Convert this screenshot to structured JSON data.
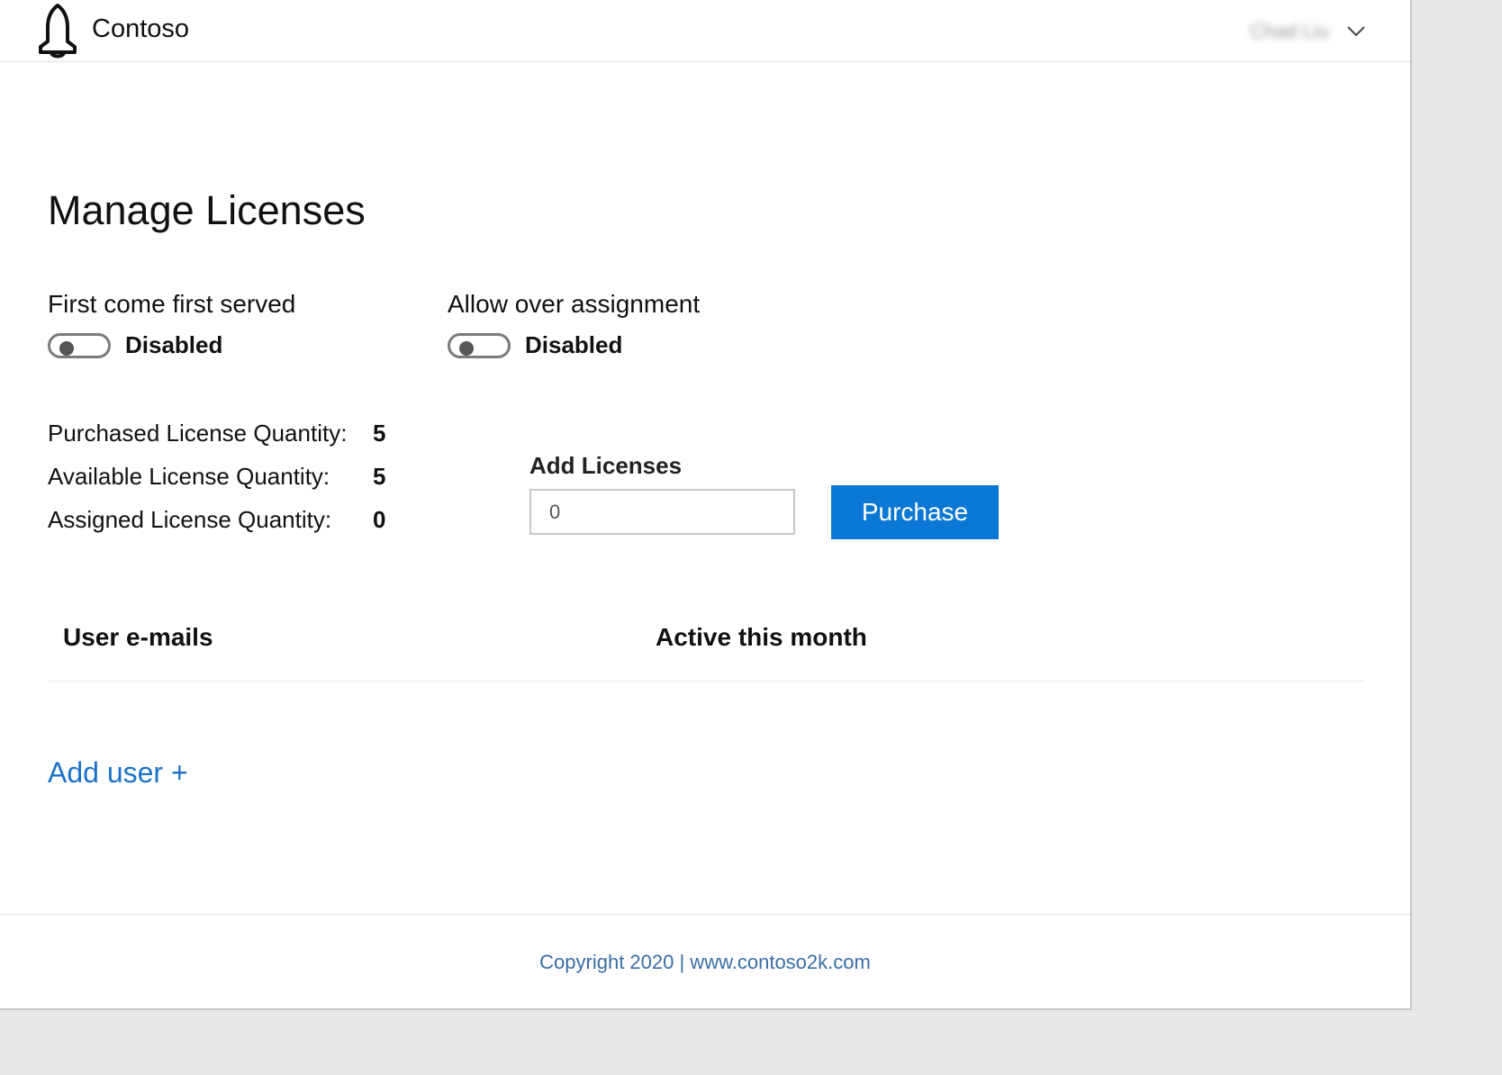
{
  "header": {
    "brand": "Contoso",
    "user_name": "Chad Liu"
  },
  "main": {
    "title": "Manage Licenses",
    "toggles": [
      {
        "label": "First come first served",
        "status": "Disabled",
        "enabled": false
      },
      {
        "label": "Allow over assignment",
        "status": "Disabled",
        "enabled": false
      }
    ],
    "quantities": [
      {
        "label": "Purchased License Quantity:",
        "value": "5"
      },
      {
        "label": "Available License Quantity:",
        "value": "5"
      },
      {
        "label": "Assigned License Quantity:",
        "value": "0"
      }
    ],
    "add_licenses": {
      "label": "Add Licenses",
      "placeholder": "0",
      "button": "Purchase"
    },
    "table": {
      "columns": [
        "User e-mails",
        "Active this month"
      ]
    },
    "add_user": "Add user +"
  },
  "footer": {
    "text": "Copyright 2020 | www.contoso2k.com"
  },
  "colors": {
    "primary": "#0a78d4",
    "link": "#1a73c8",
    "footer_text": "#3a6ea5"
  }
}
